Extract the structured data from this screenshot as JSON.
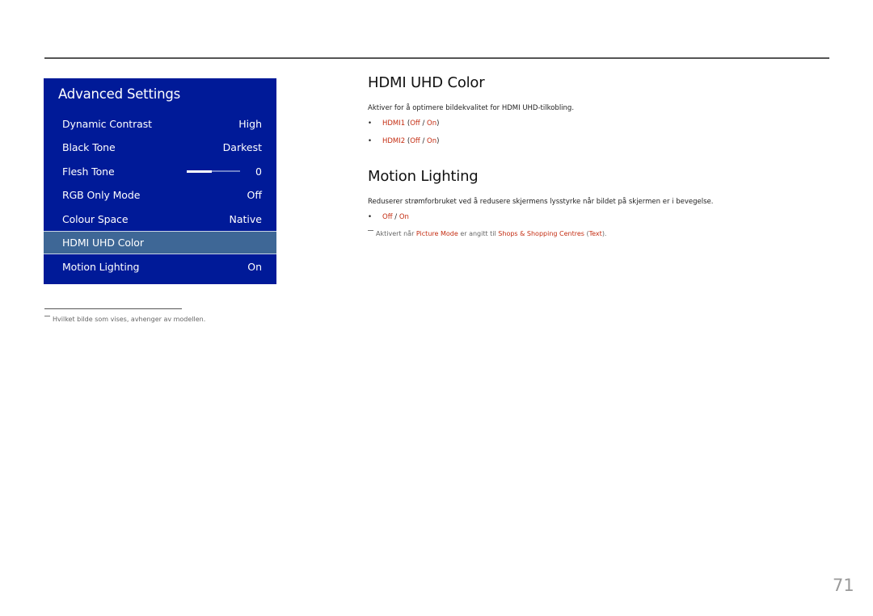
{
  "panel": {
    "title": "Advanced Settings",
    "background_color": "#001a98",
    "selected_color": "#3e6796",
    "items": [
      {
        "label": "Dynamic Contrast",
        "value": "High"
      },
      {
        "label": "Black Tone",
        "value": "Darkest"
      },
      {
        "label": "Flesh Tone",
        "value": "0",
        "slider_fraction": 0.47
      },
      {
        "label": "RGB Only Mode",
        "value": "Off"
      },
      {
        "label": "Colour Space",
        "value": "Native"
      },
      {
        "label": "HDMI UHD Color",
        "value": "",
        "selected": true
      },
      {
        "label": "Motion Lighting",
        "value": "On"
      }
    ]
  },
  "footnote": "Hvilket bilde som vises, avhenger av modellen.",
  "sections": {
    "hdmi": {
      "heading": "HDMI UHD Color",
      "description": "Aktiver for å optimere bildekvalitet for HDMI UHD-tilkobling.",
      "bullets": [
        {
          "name": "HDMI1",
          "off": "Off",
          "sep": "/",
          "on": "On"
        },
        {
          "name": "HDMI2",
          "off": "Off",
          "sep": "/",
          "on": "On"
        }
      ]
    },
    "motion": {
      "heading": "Motion Lighting",
      "description": "Reduserer strømforbruket ved å redusere skjermens lysstyrke når bildet på skjermen er i bevegelse.",
      "bullet": {
        "off": "Off",
        "sep": "/",
        "on": "On"
      },
      "note": {
        "prefix": "Aktivert når",
        "term1": "Picture Mode",
        "middle": "er angitt til",
        "term2": "Shops & Shopping Centres",
        "paren_open": "(",
        "term3": "Text",
        "paren_close": ")."
      }
    }
  },
  "page_number": "71",
  "accent_color": "#c42d12"
}
